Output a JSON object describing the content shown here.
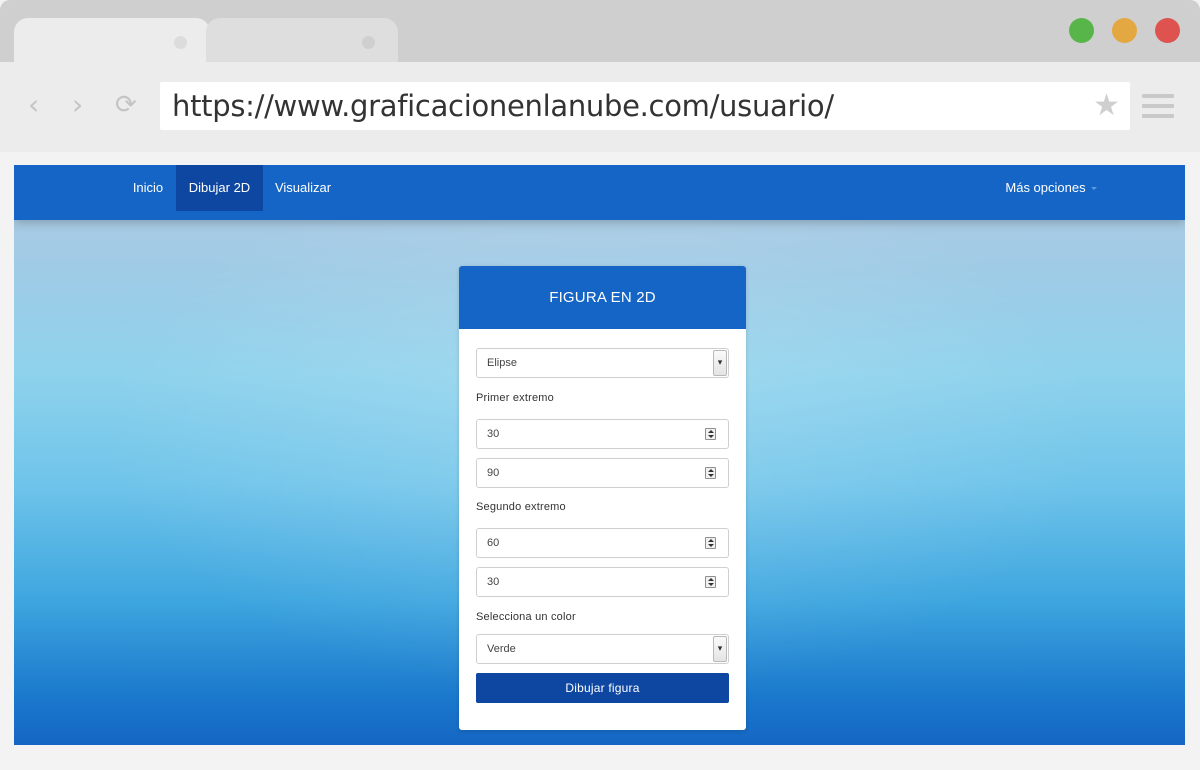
{
  "browser": {
    "url": "https://www.graficacionenlanube.com/usuario/",
    "nav_back_glyph": "‹",
    "nav_forward_glyph": "›",
    "reload_glyph": "⟳",
    "star_glyph": "★",
    "window_buttons": {
      "close": "#de5350",
      "minimize": "#e3a841",
      "maximize": "#58b54a"
    }
  },
  "navbar": {
    "items": [
      {
        "label": "Inicio",
        "active": false
      },
      {
        "label": "Dibujar 2D",
        "active": true
      },
      {
        "label": "Visualizar",
        "active": false
      }
    ],
    "more_options": "Más opciones",
    "color": "#1565c6",
    "active_color": "#0d47a1"
  },
  "form": {
    "title": "FIGURA EN 2D",
    "shape_select": {
      "value": "Elipse"
    },
    "first_point": {
      "label": "Primer extremo",
      "x": "30",
      "y": "90"
    },
    "second_point": {
      "label": "Segundo extremo",
      "x": "60",
      "y": "30"
    },
    "color_select": {
      "label": "Selecciona un color",
      "value": "Verde"
    },
    "submit_label": "Dibujar figura"
  }
}
